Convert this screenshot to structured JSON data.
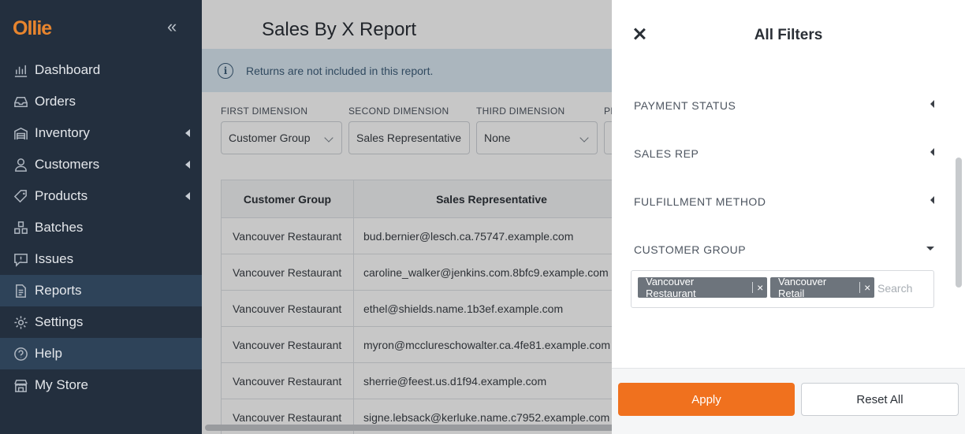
{
  "app": {
    "logo": "Ollie",
    "collapse_icon": "«"
  },
  "sidebar": {
    "items": [
      {
        "label": "Dashboard",
        "icon": "chart-icon"
      },
      {
        "label": "Orders",
        "icon": "inbox-icon"
      },
      {
        "label": "Inventory",
        "icon": "warehouse-icon",
        "expandable": true
      },
      {
        "label": "Customers",
        "icon": "user-icon",
        "expandable": true
      },
      {
        "label": "Products",
        "icon": "tag-icon",
        "expandable": true
      },
      {
        "label": "Batches",
        "icon": "boxes-icon"
      },
      {
        "label": "Issues",
        "icon": "alert-icon"
      },
      {
        "label": "Reports",
        "icon": "document-icon",
        "active": true
      },
      {
        "label": "Settings",
        "icon": "gear-icon"
      },
      {
        "label": "Help",
        "icon": "help-icon",
        "active": true
      },
      {
        "label": "My Store",
        "icon": "store-icon"
      }
    ]
  },
  "main": {
    "title": "Sales By X Report",
    "info": "Returns are not included in this report.",
    "dimensions": [
      {
        "label": "FIRST DIMENSION",
        "value": "Customer Group"
      },
      {
        "label": "SECOND DIMENSION",
        "value": "Sales Representative"
      },
      {
        "label": "THIRD DIMENSION",
        "value": "None"
      },
      {
        "label": "PI",
        "value": ""
      }
    ],
    "table": {
      "headers": [
        "Customer Group",
        "Sales Representative"
      ],
      "rows": [
        [
          "Vancouver Restaurant",
          "bud.bernier@lesch.ca.75747.example.com"
        ],
        [
          "Vancouver Restaurant",
          "caroline_walker@jenkins.com.8bfc9.example.com"
        ],
        [
          "Vancouver Restaurant",
          "ethel@shields.name.1b3ef.example.com"
        ],
        [
          "Vancouver Restaurant",
          "myron@mccluresch​owalter.ca.4fe81.example.com"
        ],
        [
          "Vancouver Restaurant",
          "sherrie@feest.us.d1f94.example.com"
        ],
        [
          "Vancouver Restaurant",
          "signe.lebsack@kerluke.name.c7952.example.com"
        ]
      ]
    }
  },
  "filters": {
    "title": "All Filters",
    "sections": [
      {
        "label": "PAYMENT STATUS",
        "expanded": false
      },
      {
        "label": "SALES REP",
        "expanded": false
      },
      {
        "label": "FULFILLMENT METHOD",
        "expanded": false
      },
      {
        "label": "CUSTOMER GROUP",
        "expanded": true
      }
    ],
    "selected_tags": [
      "Vancouver Restaurant",
      "Vancouver Retail"
    ],
    "tag_remove": "×",
    "search_placeholder": "Search",
    "apply_label": "Apply",
    "reset_label": "Reset All",
    "accent_color": "#f0711e"
  }
}
